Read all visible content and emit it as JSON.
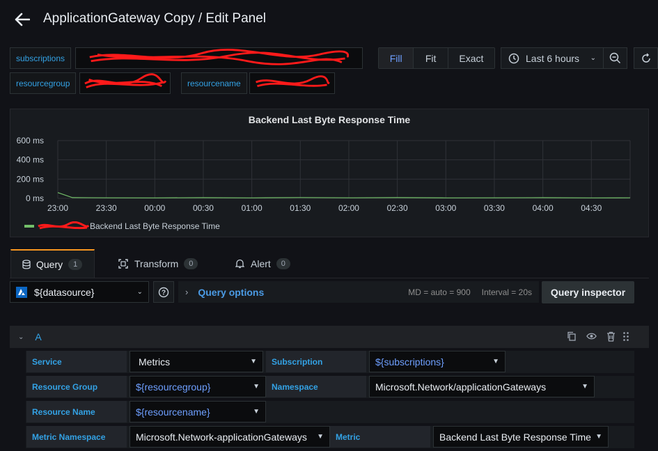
{
  "header": {
    "title": "ApplicationGateway Copy / Edit Panel"
  },
  "variables": {
    "subscriptions_label": "subscriptions",
    "resourcegroup_label": "resourcegroup",
    "resourcename_label": "resourcename"
  },
  "toolbar": {
    "fill": "Fill",
    "fit": "Fit",
    "exact": "Exact",
    "time_range": "Last 6 hours"
  },
  "panel": {
    "title": "Backend Last Byte Response Time",
    "legend_suffix": "Backend Last Byte Response Time"
  },
  "chart_data": {
    "type": "line",
    "title": "Backend Last Byte Response Time",
    "y_ticks": [
      "600 ms",
      "400 ms",
      "200 ms",
      "0 ms"
    ],
    "x_ticks": [
      "23:00",
      "23:30",
      "00:00",
      "00:30",
      "01:00",
      "01:30",
      "02:00",
      "02:30",
      "03:00",
      "03:30",
      "04:00",
      "04:30"
    ],
    "ylim": [
      0,
      600
    ],
    "grid": true,
    "legend_placement": "bottom-left",
    "series": [
      {
        "name": "Backend Last Byte Response Time",
        "color": "#73bf69",
        "points": [
          [
            0,
            60
          ],
          [
            0.3,
            8
          ],
          [
            1,
            6
          ],
          [
            2,
            5
          ],
          [
            3,
            7
          ],
          [
            4,
            5
          ],
          [
            5,
            9
          ],
          [
            6,
            6
          ],
          [
            7,
            8
          ],
          [
            8,
            5
          ],
          [
            9,
            6
          ],
          [
            10,
            7
          ],
          [
            11,
            5
          ],
          [
            11.8,
            6
          ]
        ]
      }
    ]
  },
  "tabs": [
    {
      "label": "Query",
      "count": "1"
    },
    {
      "label": "Transform",
      "count": "0"
    },
    {
      "label": "Alert",
      "count": "0"
    }
  ],
  "query_bar": {
    "datasource": "${datasource}",
    "options_label": "Query options",
    "md_info": "MD = auto = 900",
    "interval_info": "Interval = 20s",
    "inspector": "Query inspector"
  },
  "query": {
    "ref_id": "A",
    "service_label": "Service",
    "service_value": "Metrics",
    "subscription_label": "Subscription",
    "subscription_value": "${subscriptions}",
    "resource_group_label": "Resource Group",
    "resource_group_value": "${resourcegroup}",
    "namespace_label": "Namespace",
    "namespace_value": "Microsoft.Network/applicationGateways",
    "resource_name_label": "Resource Name",
    "resource_name_value": "${resourcename}",
    "metric_namespace_label": "Metric Namespace",
    "metric_namespace_value": "Microsoft.Network-applicationGateways",
    "metric_label": "Metric",
    "metric_value": "Backend Last Byte Response Time"
  },
  "colors": {
    "accent": "#33a2e5",
    "tab_active": "#f79520",
    "series": "#73bf69",
    "redaction": "#ff0000"
  }
}
